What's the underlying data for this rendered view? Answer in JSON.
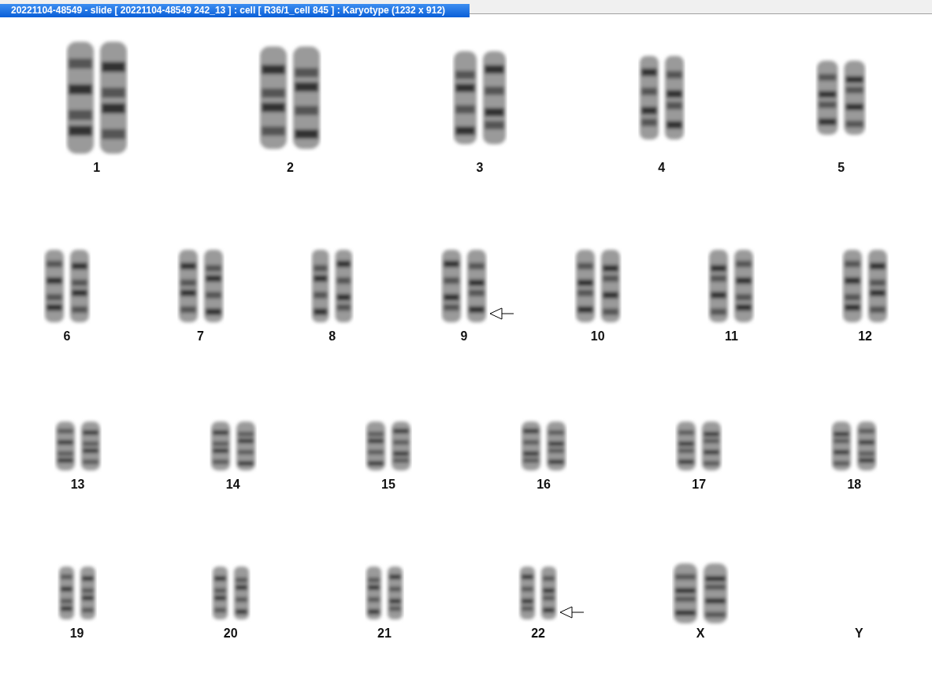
{
  "window": {
    "title": "20221104-48549 - slide [ 20221104-48549 242_13 ] : cell [ R36/1_cell 845 ] : Karyotype  (1232 x 912)"
  },
  "karyotype": {
    "rows": [
      [
        {
          "label": "1",
          "kind": "pair",
          "marked": false
        },
        {
          "label": "2",
          "kind": "pair",
          "marked": false
        },
        {
          "label": "3",
          "kind": "pair",
          "marked": false
        },
        {
          "label": "4",
          "kind": "pair",
          "marked": false
        },
        {
          "label": "5",
          "kind": "pair",
          "marked": false
        }
      ],
      [
        {
          "label": "6",
          "kind": "pair",
          "marked": false
        },
        {
          "label": "7",
          "kind": "pair",
          "marked": false
        },
        {
          "label": "8",
          "kind": "pair",
          "marked": false
        },
        {
          "label": "9",
          "kind": "pair",
          "marked": true
        },
        {
          "label": "10",
          "kind": "pair",
          "marked": false
        },
        {
          "label": "11",
          "kind": "pair",
          "marked": false
        },
        {
          "label": "12",
          "kind": "pair",
          "marked": false
        }
      ],
      [
        {
          "label": "13",
          "kind": "pair",
          "marked": false
        },
        {
          "label": "14",
          "kind": "pair",
          "marked": false
        },
        {
          "label": "15",
          "kind": "pair",
          "marked": false
        },
        {
          "label": "16",
          "kind": "pair",
          "marked": false
        },
        {
          "label": "17",
          "kind": "pair",
          "marked": false
        },
        {
          "label": "18",
          "kind": "pair",
          "marked": false
        }
      ],
      [
        {
          "label": "19",
          "kind": "pair",
          "marked": false
        },
        {
          "label": "20",
          "kind": "pair",
          "marked": false
        },
        {
          "label": "21",
          "kind": "pair",
          "marked": false
        },
        {
          "label": "22",
          "kind": "pair",
          "marked": true
        },
        {
          "label": "X",
          "kind": "pair",
          "marked": false
        },
        {
          "label": "Y",
          "kind": "none",
          "marked": false
        }
      ]
    ]
  }
}
